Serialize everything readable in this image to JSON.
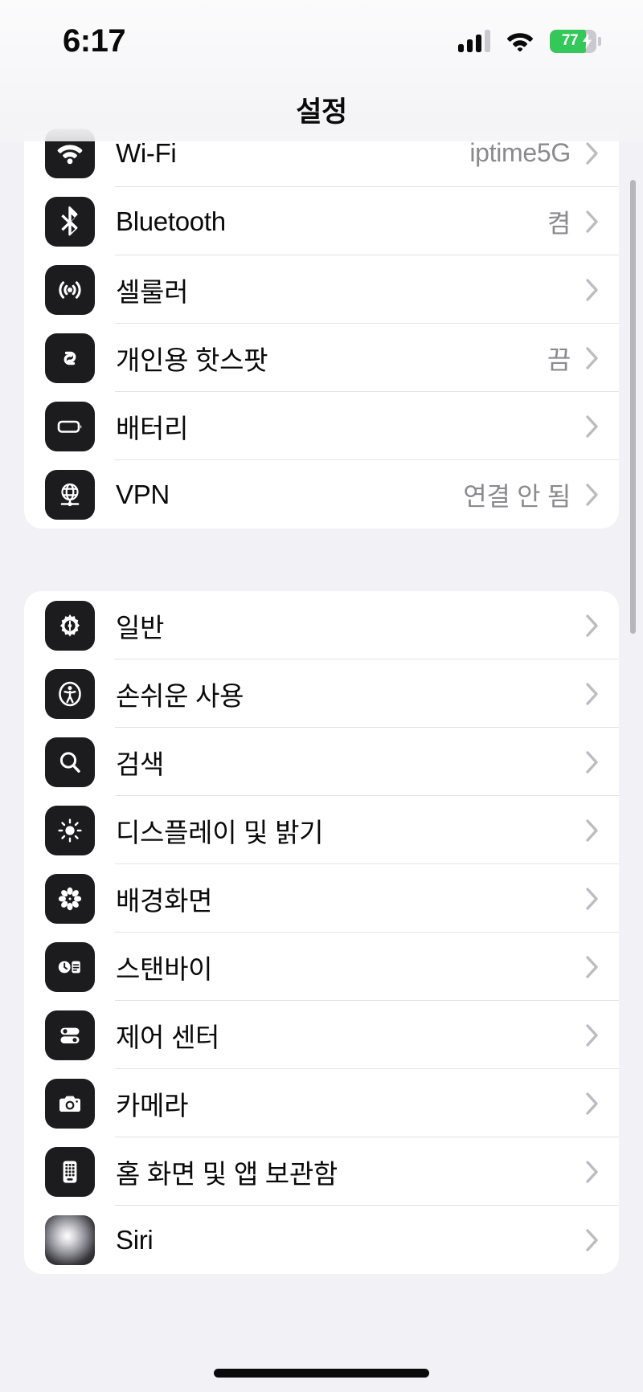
{
  "status_bar": {
    "time": "6:17",
    "cellular_icon": "cellular-bars-icon",
    "cellular_bars_filled": 3,
    "cellular_bars_total": 4,
    "wifi_icon": "wifi-icon",
    "battery_icon": "battery-icon",
    "battery_level": "77",
    "battery_charging": true,
    "battery_color": "#34c759"
  },
  "navbar": {
    "title": "설정"
  },
  "sections": [
    {
      "id": "connectivity",
      "rows": [
        {
          "icon": "wifi-icon",
          "label": "Wi-Fi",
          "value": "iptime5G"
        },
        {
          "icon": "bluetooth-icon",
          "label": "Bluetooth",
          "value": "켬"
        },
        {
          "icon": "cellular-icon",
          "label": "셀룰러",
          "value": ""
        },
        {
          "icon": "personal-hotspot-icon",
          "label": "개인용 핫스팟",
          "value": "끔"
        },
        {
          "icon": "battery-icon",
          "label": "배터리",
          "value": ""
        },
        {
          "icon": "vpn-globe-icon",
          "label": "VPN",
          "value": "연결 안 됨"
        }
      ]
    },
    {
      "id": "system",
      "rows": [
        {
          "icon": "gear-icon",
          "label": "일반",
          "value": ""
        },
        {
          "icon": "accessibility-icon",
          "label": "손쉬운 사용",
          "value": ""
        },
        {
          "icon": "search-icon",
          "label": "검색",
          "value": ""
        },
        {
          "icon": "brightness-icon",
          "label": "디스플레이 및 밝기",
          "value": ""
        },
        {
          "icon": "wallpaper-flower-icon",
          "label": "배경화면",
          "value": ""
        },
        {
          "icon": "standby-icon",
          "label": "스탠바이",
          "value": ""
        },
        {
          "icon": "control-center-icon",
          "label": "제어 센터",
          "value": ""
        },
        {
          "icon": "camera-icon",
          "label": "카메라",
          "value": ""
        },
        {
          "icon": "home-screen-icon",
          "label": "홈 화면 및 앱 보관함",
          "value": ""
        },
        {
          "icon": "siri-orb-icon",
          "label": "Siri",
          "value": ""
        }
      ]
    }
  ],
  "chevron_icon": "chevron-right-icon",
  "scroll_indicator": "vertical-scrollbar",
  "home_indicator": "home-indicator-bar",
  "colors": {
    "background": "#f2f1f6",
    "card": "#ffffff",
    "icon_tile": "#1c1c1e",
    "secondary_text": "#8a8a8f",
    "separator": "#e2e2e6"
  }
}
